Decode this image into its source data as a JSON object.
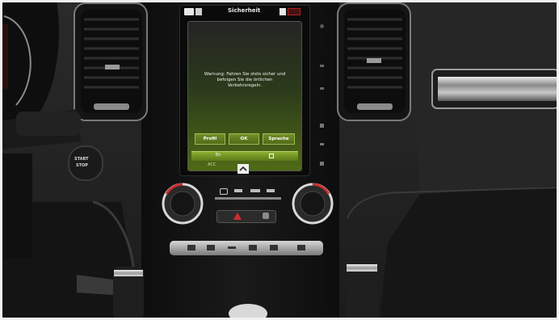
{
  "screen": {
    "header_title": "Sicherheit",
    "warning_text": "Warnung: Fahren Sie stets sicher und befolgen Sie die örtlichen Verkehrsregeln.",
    "buttons": [
      {
        "label": "Profil"
      },
      {
        "label": "OK"
      },
      {
        "label": "Sprache"
      }
    ],
    "bar_left_label": "En",
    "bar_bottom_label": "ACC"
  },
  "start_stop_button": {
    "line1": "START",
    "line2": "STOP"
  },
  "icons": {
    "screen_home": "home-icon",
    "screen_status": "status-icon",
    "hazard": "hazard-triangle-icon",
    "chevron": "chevron-up-icon"
  },
  "colors": {
    "screen_green": "#5a7a1a",
    "hazard_red": "#d22b2b",
    "knob_ring_red": "#c8302e"
  }
}
